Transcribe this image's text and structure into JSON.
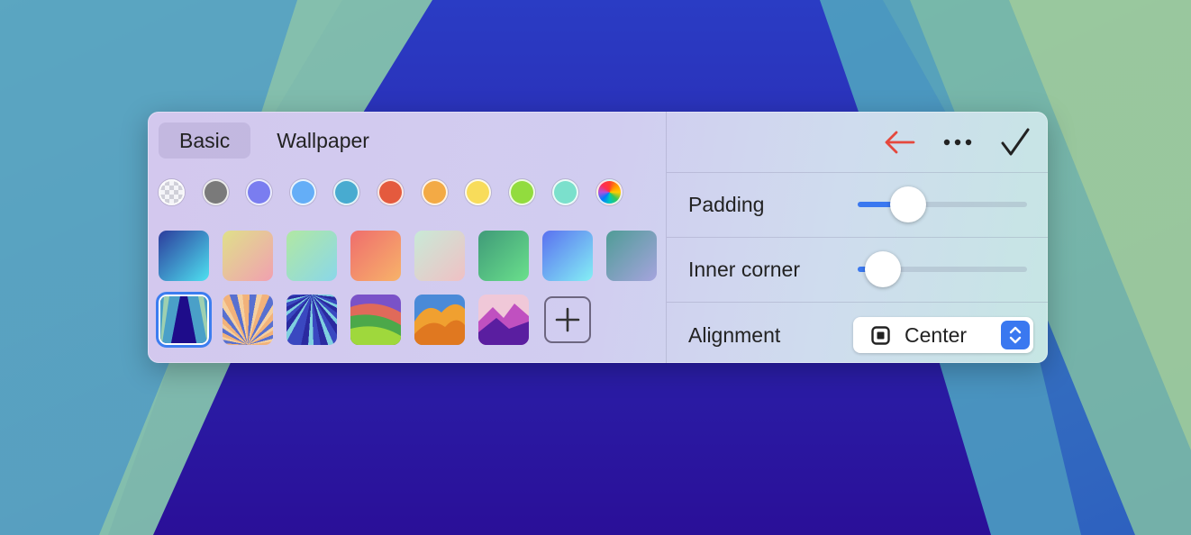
{
  "tabs": [
    {
      "label": "Basic",
      "active": true
    },
    {
      "label": "Wallpaper",
      "active": false
    }
  ],
  "solid_colors": [
    "transparent",
    "#7a7a7a",
    "#7a7df0",
    "#64aef7",
    "#48abd0",
    "#e45a3e",
    "#f3aa45",
    "#f8dc5a",
    "#92dc3e",
    "#7be0cc",
    "spectrum"
  ],
  "gradients": [
    [
      "#2c3c9c",
      "#4ee1f0"
    ],
    [
      "#dfe08a",
      "#f1a0b0"
    ],
    [
      "#b1e8a2",
      "#8ad7e9"
    ],
    [
      "#ef6d6d",
      "#f7b36a"
    ],
    [
      "#c8ead7",
      "#f0c0c4"
    ],
    [
      "#3f9a78",
      "#6ae08c"
    ],
    [
      "#5a70f0",
      "#84f0f5"
    ],
    [
      "#4f9c96",
      "#a6a4de"
    ]
  ],
  "wallpapers": [
    {
      "name": "blue-road-wallpaper",
      "selected": true
    },
    {
      "name": "orange-rays-wallpaper",
      "selected": false
    },
    {
      "name": "blue-rays-wallpaper",
      "selected": false
    },
    {
      "name": "green-hills-wallpaper",
      "selected": false
    },
    {
      "name": "orange-dunes-wallpaper",
      "selected": false
    },
    {
      "name": "purple-mountains-wallpaper",
      "selected": false
    }
  ],
  "toolbar": {
    "back_icon": "arrow-left-icon",
    "back_color": "#e5483d",
    "more_icon": "ellipsis-icon",
    "confirm_icon": "checkmark-icon"
  },
  "settings": {
    "padding": {
      "label": "Padding",
      "value": 0.3
    },
    "inner_corner": {
      "label": "Inner corner",
      "value": 0.15
    },
    "alignment": {
      "label": "Alignment",
      "value": "Center"
    }
  },
  "accent_color": "#3a78f0"
}
